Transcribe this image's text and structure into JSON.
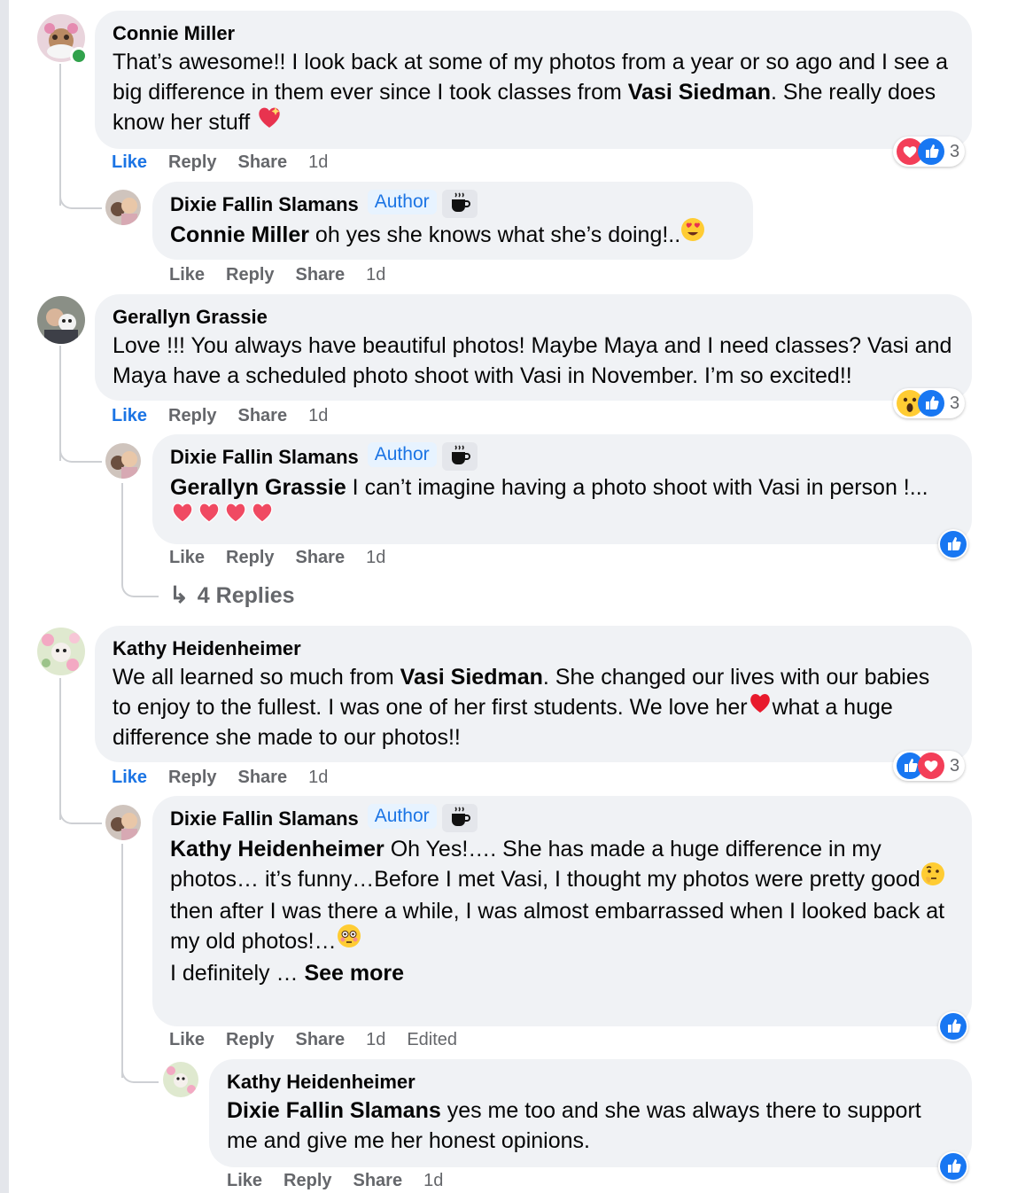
{
  "thread": {
    "c1": {
      "name": "Connie Miller",
      "text_a": "That’s awesome!! I look back at some of my photos from a year or so ago and I see a big difference in them ever since I took classes from ",
      "mention": "Vasi Siedman",
      "text_b": ". She really does know her stuff ",
      "emoji": "sparkling-heart",
      "actions": {
        "like": "Like",
        "reply": "Reply",
        "share": "Share",
        "time": "1d"
      },
      "reactions": {
        "icons": [
          "love",
          "like"
        ],
        "count": "3"
      }
    },
    "r1": {
      "name": "Dixie Fallin Slamans",
      "badge": "Author",
      "badge_icon": "coffee-cup-icon",
      "mention": "Connie Miller",
      "text": " oh yes she knows what she’s doing!..",
      "emoji": "heart-eyes",
      "actions": {
        "like": "Like",
        "reply": "Reply",
        "share": "Share",
        "time": "1d"
      }
    },
    "c2": {
      "name": "Gerallyn Grassie",
      "text": "Love !!! You always have beautiful photos! Maybe Maya and I need classes? Vasi and Maya have a scheduled photo shoot with Vasi in November. I’m so excited!!",
      "actions": {
        "like": "Like",
        "reply": "Reply",
        "share": "Share",
        "time": "1d"
      },
      "reactions": {
        "icons": [
          "wow",
          "like"
        ],
        "count": "3"
      }
    },
    "r2": {
      "name": "Dixie Fallin Slamans",
      "badge": "Author",
      "badge_icon": "coffee-cup-icon",
      "mention": "Gerallyn Grassie",
      "text": " I can’t imagine having a photo shoot with Vasi in person !...",
      "emoji": "heart x4",
      "actions": {
        "like": "Like",
        "reply": "Reply",
        "share": "Share",
        "time": "1d"
      },
      "reactions": {
        "icons": [
          "like"
        ]
      }
    },
    "more_replies": "4 Replies",
    "c3": {
      "name": "Kathy Heidenheimer",
      "text_a": "We all learned so much from ",
      "mention": "Vasi Siedman",
      "text_b": ". She changed our lives with our babies to enjoy to the fullest. I was one of her first students. We love her",
      "text_c": "what a huge difference she made to our photos!!",
      "actions": {
        "like": "Like",
        "reply": "Reply",
        "share": "Share",
        "time": "1d"
      },
      "reactions": {
        "icons": [
          "like",
          "love"
        ],
        "count": "3"
      }
    },
    "r3": {
      "name": "Dixie Fallin Slamans",
      "badge": "Author",
      "badge_icon": "coffee-cup-icon",
      "mention": "Kathy Heidenheimer",
      "line1": " Oh Yes!…. She has made a huge difference in my photos… it’s funny…Before I met Vasi, I thought my photos were pretty good",
      "line2": "then after I was there a while, I was almost embarrassed when I looked back at my old photos!…",
      "line3": "I definitely … ",
      "see_more": "See more",
      "actions": {
        "like": "Like",
        "reply": "Reply",
        "share": "Share",
        "time": "1d",
        "edited": "Edited"
      },
      "reactions": {
        "icons": [
          "like"
        ]
      }
    },
    "r4": {
      "name": "Kathy Heidenheimer",
      "mention": "Dixie Fallin Slamans",
      "text": " yes me too and she was always there to support me and give me her honest opinions.",
      "actions": {
        "like": "Like",
        "reply": "Reply",
        "share": "Share",
        "time": "1d"
      },
      "reactions": {
        "icons": [
          "like"
        ]
      }
    }
  },
  "colors": {
    "link_blue": "#1b74e4",
    "bubble": "#f0f2f5",
    "muted": "#65676b",
    "like": "#1877f2",
    "love": "#f33e58"
  }
}
